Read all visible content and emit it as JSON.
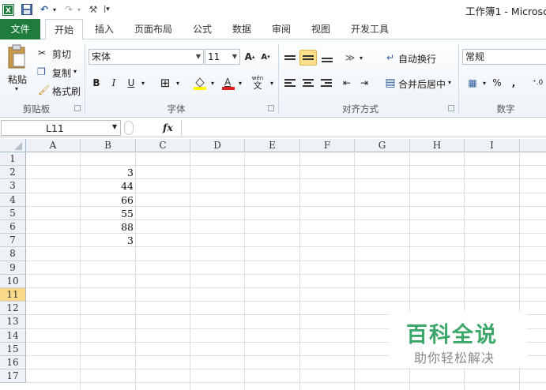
{
  "window": {
    "title": "工作簿1 - Microso",
    "quick_access": [
      "excel-logo-icon",
      "save-icon",
      "undo-icon",
      "redo-icon",
      "customize-icon"
    ]
  },
  "tabs": [
    "文件",
    "开始",
    "插入",
    "页面布局",
    "公式",
    "数据",
    "审阅",
    "视图",
    "开发工具"
  ],
  "active_tab": "开始",
  "ribbon": {
    "clipboard": {
      "paste": "粘贴",
      "cut": "剪切",
      "copy": "复制",
      "format_painter": "格式刷",
      "label": "剪贴板"
    },
    "font": {
      "font_name": "宋体",
      "font_size": "11",
      "bold": "B",
      "italic": "I",
      "underline": "U",
      "phonetic": "wén",
      "label": "字体"
    },
    "alignment": {
      "wrap_text": "自动换行",
      "merge_center": "合并后居中",
      "label": "对齐方式"
    },
    "number": {
      "format": "常规",
      "percent": "%",
      "comma": ",",
      "label": "数字"
    }
  },
  "formula_bar": {
    "name_box": "L11",
    "fx": "fx",
    "formula": ""
  },
  "grid": {
    "columns": [
      "A",
      "B",
      "C",
      "D",
      "E",
      "F",
      "G",
      "H",
      "I"
    ],
    "rows": [
      "1",
      "2",
      "3",
      "4",
      "5",
      "6",
      "7",
      "8",
      "9",
      "10",
      "11",
      "12",
      "13",
      "14",
      "15",
      "16",
      "17"
    ],
    "selected_row": "11",
    "column_b_values": [
      "",
      "3",
      "44",
      "66",
      "55",
      "88",
      "3"
    ]
  },
  "watermark": {
    "title": "百科全说",
    "subtitle": "助你轻松解决"
  },
  "colors": {
    "file_tab": "#1f7b3e",
    "selected_row_header": "#f9d88a",
    "watermark": "#3ba86a"
  }
}
